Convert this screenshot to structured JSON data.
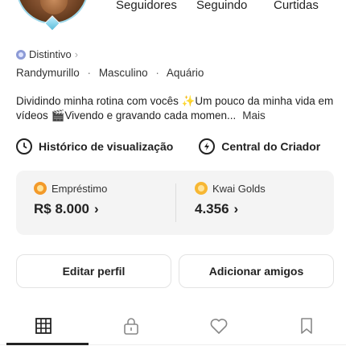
{
  "profile": {
    "stats": {
      "followers_label": "Seguidores",
      "following_label": "Seguindo",
      "likes_label": "Curtidas"
    },
    "badge": {
      "label": "Distintivo",
      "chevron": "›",
      "icon": "badge-icon"
    },
    "info": {
      "username": "Randymurillo",
      "separator": "·",
      "gender": "Masculino",
      "sign": "Aquário"
    },
    "bio": {
      "text": "Dividindo minha rotina com vocês ✨Um pouco da minha vida em vídeos 🎬Vivendo e gravando cada momen...",
      "more_label": "Mais"
    }
  },
  "links": {
    "history_label": "Histórico de visualização",
    "creator_label": "Central do Criador"
  },
  "wallet": {
    "loan": {
      "label": "Empréstimo",
      "value": "R$ 8.000",
      "chevron": "›"
    },
    "golds": {
      "label": "Kwai Golds",
      "value": "4.356",
      "chevron": "›"
    }
  },
  "buttons": {
    "edit_label": "Editar perfil",
    "add_friends_label": "Adicionar amigos"
  },
  "tabs": {
    "items": [
      "grid-icon",
      "lock-icon",
      "heart-icon",
      "bookmark-icon"
    ],
    "active_index": 0
  },
  "colors": {
    "accent": "#222222",
    "coin_gold": "#f7b733",
    "coin_orange": "#f39a2a",
    "badge_blue": "#8d9bd6"
  }
}
